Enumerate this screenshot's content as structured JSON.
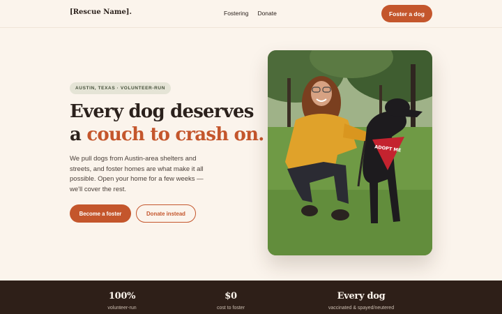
{
  "header": {
    "brand": "[Rescue Name].",
    "nav": [
      "Fostering",
      "Donate"
    ],
    "cta": "Foster a dog"
  },
  "hero": {
    "badge": "AUSTIN, TEXAS · VOLUNTEER-RUN",
    "headline_line1": "Every dog deserves",
    "headline_prefix": "a",
    "headline_accent": "couch to crash on.",
    "description": "We pull dogs from Austin-area shelters and streets, and foster homes are what make it all possible. Open your home for a few weeks — we'll cover the rest.",
    "primary_button": "Become a foster",
    "secondary_button": "Donate instead",
    "bandana_text": "ADOPT ME"
  },
  "stats": [
    {
      "value": "100%",
      "label": "volunteer-run"
    },
    {
      "value": "$0",
      "label": "cost to foster"
    },
    {
      "value": "Every dog",
      "label": "vaccinated & spayed/neutered"
    }
  ],
  "colors": {
    "background": "#fbf4ec",
    "accent": "#c4562c",
    "dark": "#2e1f18",
    "text": "#2b211c"
  }
}
